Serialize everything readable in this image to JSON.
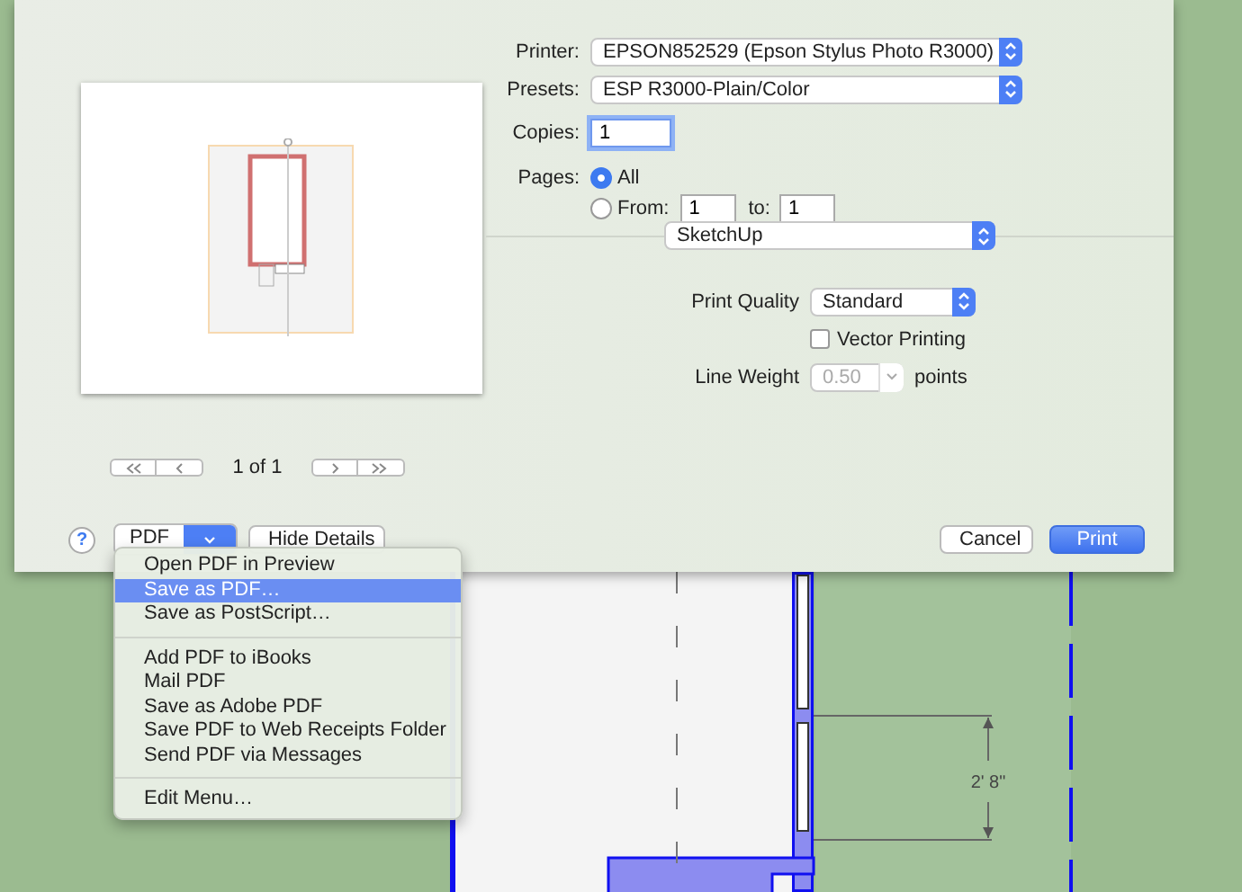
{
  "print_dialog": {
    "preview": {
      "page_label": "1 of 1"
    },
    "printer": {
      "label": "Printer:",
      "value": "EPSON852529 (Epson Stylus Photo R3000)"
    },
    "presets": {
      "label": "Presets:",
      "value": "ESP R3000-Plain/Color"
    },
    "copies": {
      "label": "Copies:",
      "value": "1"
    },
    "pages": {
      "label": "Pages:",
      "options": [
        {
          "label": "All",
          "selected": true
        },
        {
          "label": "From:",
          "selected": false
        }
      ],
      "from": "1",
      "to_label": "to:",
      "to": "1"
    },
    "section": {
      "value": "SketchUp"
    },
    "print_quality": {
      "label": "Print Quality",
      "value": "Standard"
    },
    "vector_printing": {
      "label": "Vector Printing",
      "checked": false
    },
    "line_weight": {
      "label": "Line Weight",
      "value": "0.50",
      "disabled": true,
      "units": "points"
    },
    "help": "?",
    "pdf_button": "PDF",
    "hide_details": "Hide Details",
    "cancel": "Cancel",
    "print": "Print"
  },
  "pdf_menu": {
    "groups": [
      {
        "items": [
          {
            "label": "Open PDF in Preview",
            "selected": false
          },
          {
            "label": "Save as PDF…",
            "selected": true
          },
          {
            "label": "Save as PostScript…",
            "selected": false
          }
        ]
      },
      {
        "items": [
          {
            "label": "Add PDF to iBooks",
            "selected": false
          },
          {
            "label": "Mail PDF",
            "selected": false
          },
          {
            "label": "Save as Adobe PDF",
            "selected": false
          },
          {
            "label": "Save PDF to Web Receipts Folder",
            "selected": false
          },
          {
            "label": "Send PDF via Messages",
            "selected": false
          }
        ]
      },
      {
        "items": [
          {
            "label": "Edit Menu…",
            "selected": false
          }
        ]
      }
    ]
  },
  "canvas": {
    "dimension": "2' 8\""
  }
}
